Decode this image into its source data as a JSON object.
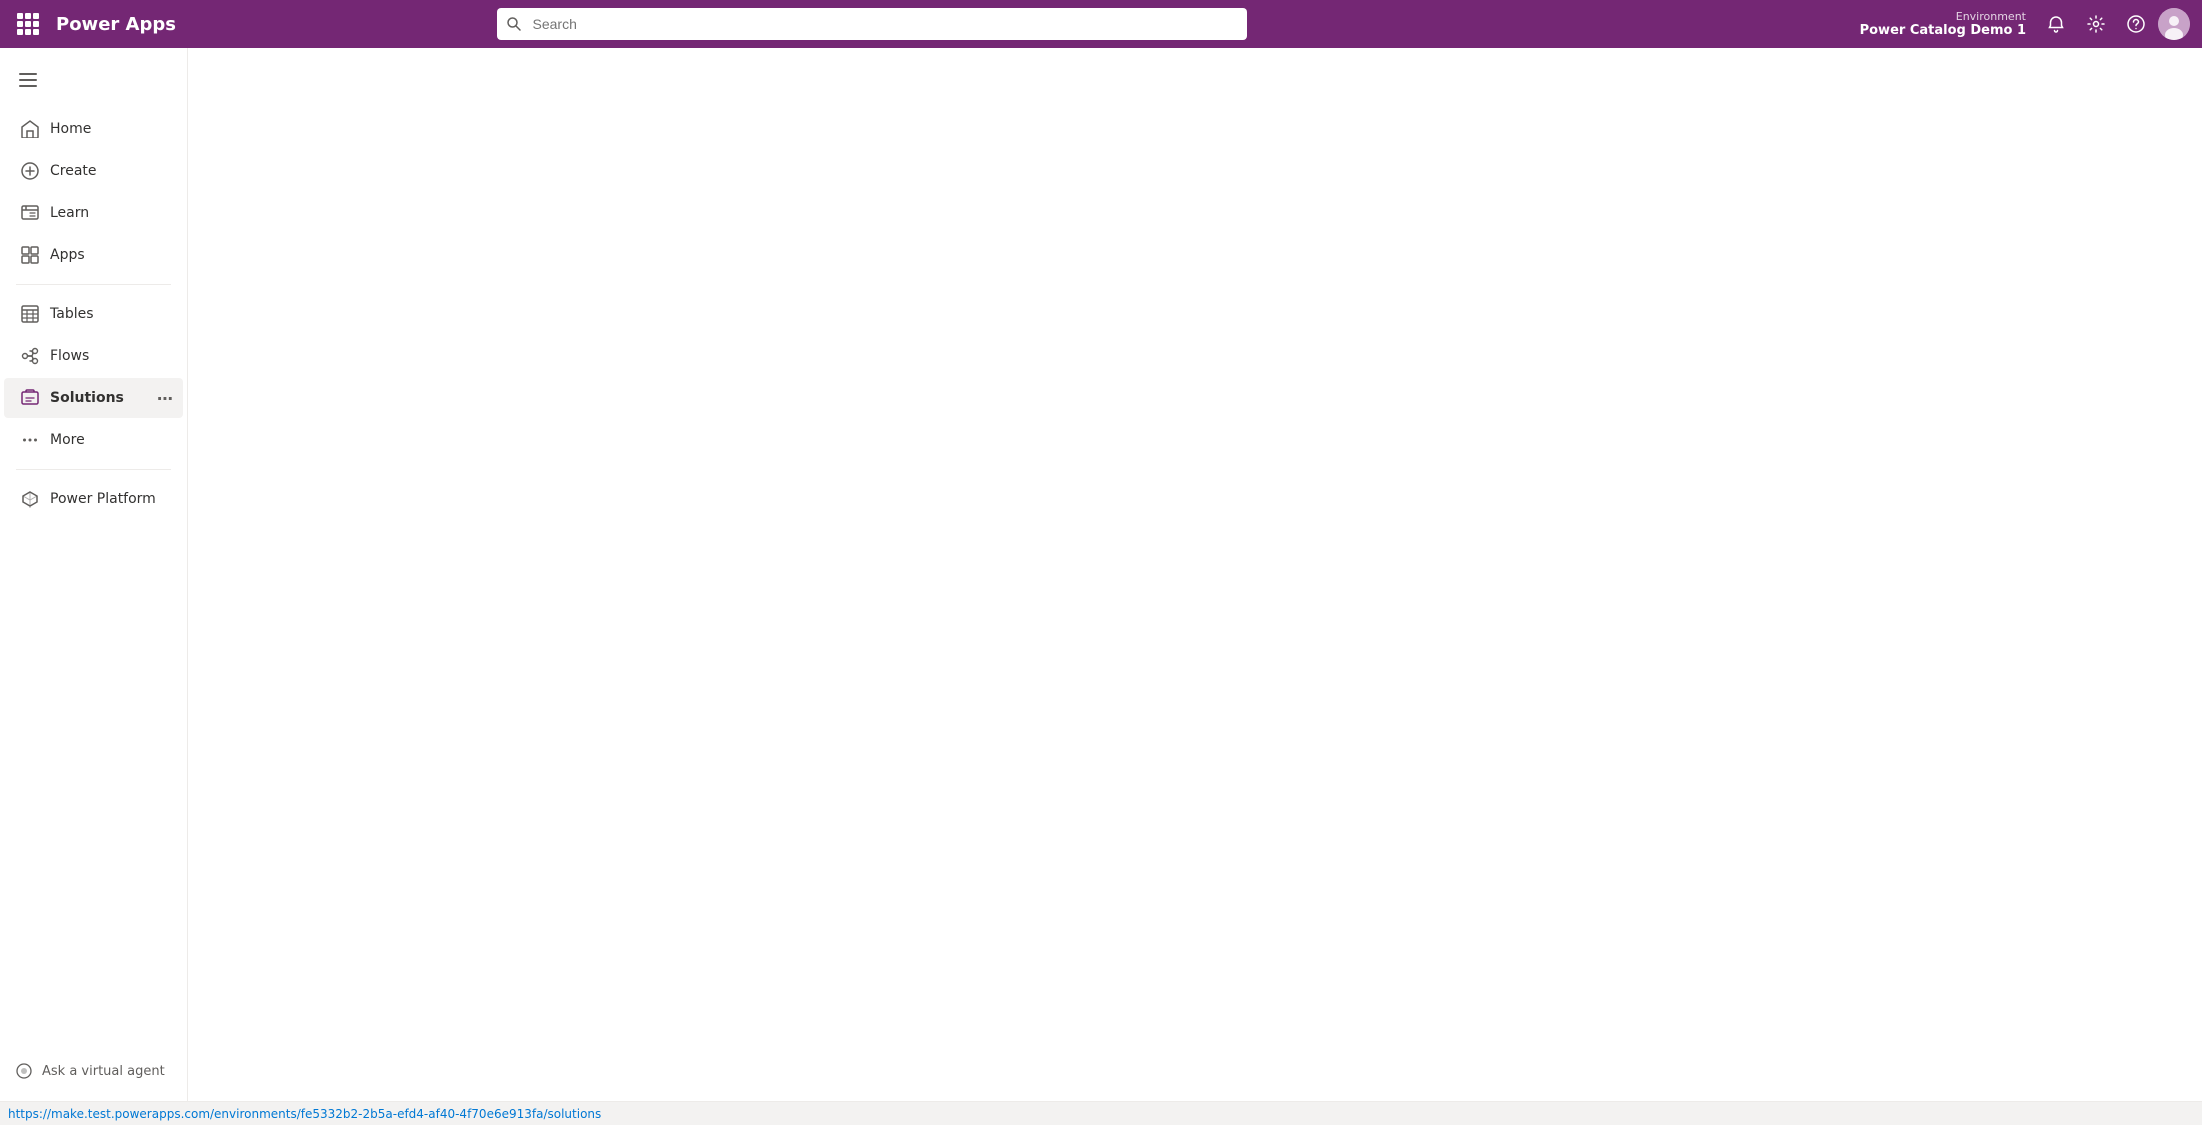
{
  "header": {
    "app_name": "Power Apps",
    "search_placeholder": "Search",
    "environment_label": "Environment",
    "environment_name": "Power Catalog Demo 1"
  },
  "sidebar": {
    "toggle_label": "Toggle navigation",
    "items": [
      {
        "id": "home",
        "label": "Home",
        "icon": "home-icon"
      },
      {
        "id": "create",
        "label": "Create",
        "icon": "create-icon"
      },
      {
        "id": "learn",
        "label": "Learn",
        "icon": "learn-icon"
      },
      {
        "id": "apps",
        "label": "Apps",
        "icon": "apps-icon"
      },
      {
        "id": "tables",
        "label": "Tables",
        "icon": "tables-icon"
      },
      {
        "id": "flows",
        "label": "Flows",
        "icon": "flows-icon"
      },
      {
        "id": "solutions",
        "label": "Solutions",
        "icon": "solutions-icon",
        "active": true
      },
      {
        "id": "more",
        "label": "More",
        "icon": "more-icon"
      }
    ],
    "bottom_items": [
      {
        "id": "power-platform",
        "label": "Power Platform",
        "icon": "power-platform-icon"
      }
    ],
    "virtual_agent_label": "Ask a virtual agent"
  },
  "status_bar": {
    "url": "https://make.test.powerapps.com/environments/fe5332b2-2b5a-efd4-af40-4f70e6e913fa/solutions"
  }
}
